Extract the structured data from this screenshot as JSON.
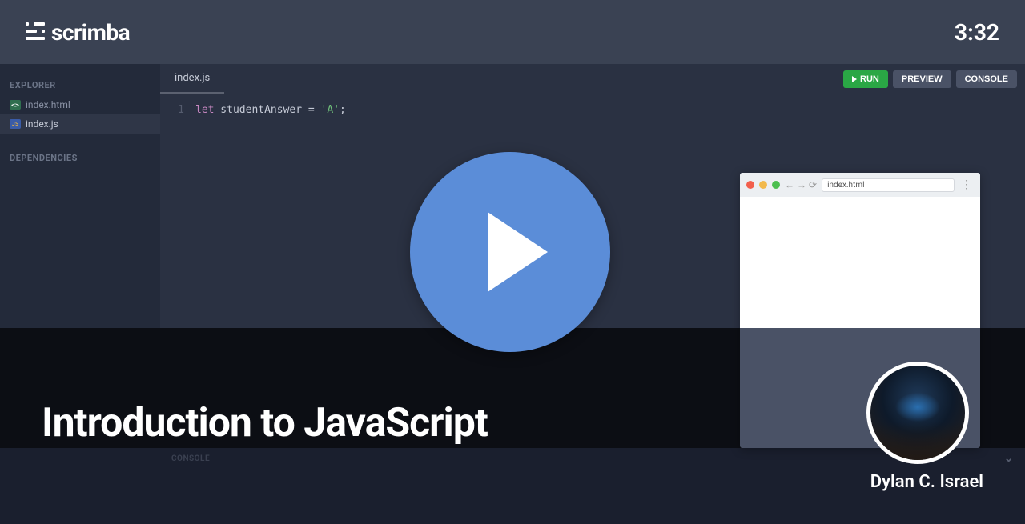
{
  "header": {
    "brand": "scrimba",
    "timestamp": "3:32"
  },
  "sidebar": {
    "explorer_label": "EXPLORER",
    "dependencies_label": "DEPENDENCIES",
    "files": [
      {
        "name": "index.html",
        "icon": "<>",
        "type": "html"
      },
      {
        "name": "index.js",
        "icon": "JS",
        "type": "js",
        "active": true
      }
    ]
  },
  "editor": {
    "active_tab": "index.js",
    "buttons": {
      "run": "RUN",
      "preview": "PREVIEW",
      "console": "CONSOLE"
    },
    "code": {
      "line_number": "1",
      "kw": "let",
      "ident": " studentAnswer ",
      "op": "=",
      "str": " 'A'",
      "punct": ";"
    }
  },
  "preview_window": {
    "address": "index.html"
  },
  "console_panel": {
    "label": "CONSOLE"
  },
  "overlay": {
    "title": "Introduction to JavaScript",
    "author": "Dylan C. Israel"
  }
}
